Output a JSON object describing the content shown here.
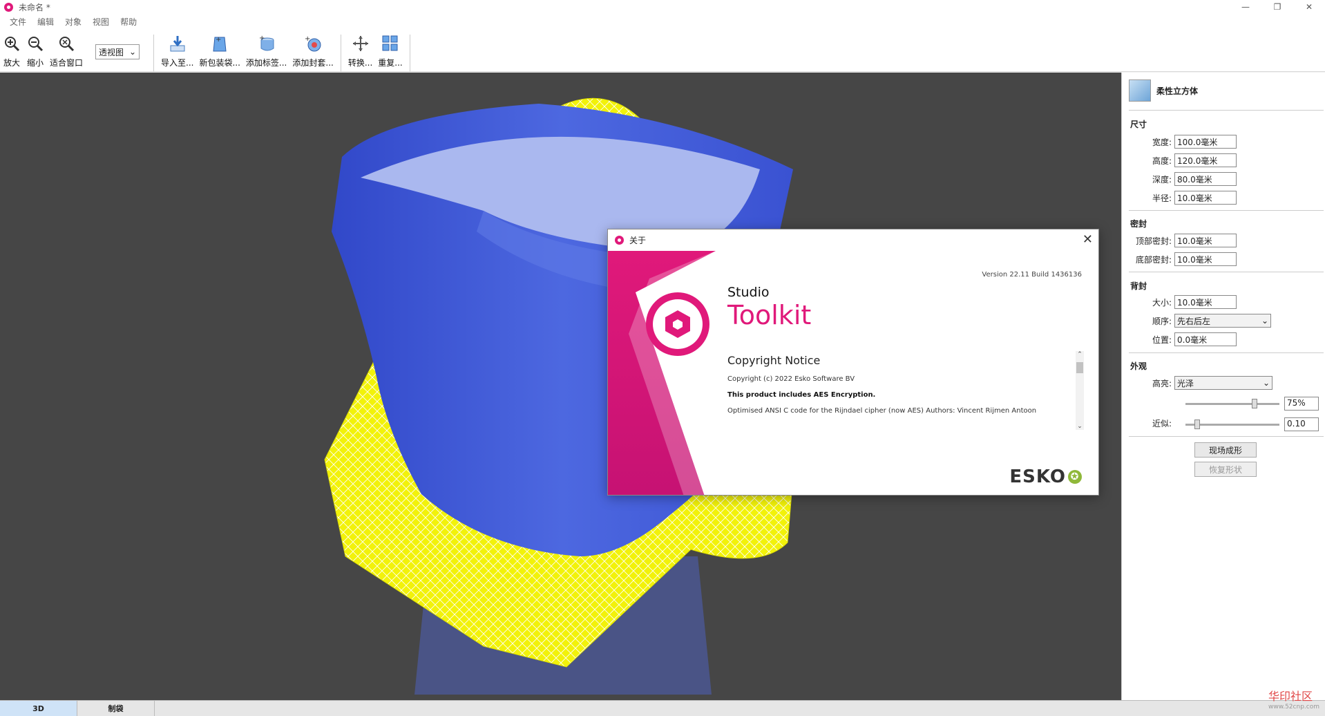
{
  "window": {
    "title": "未命名 *",
    "min": "—",
    "max": "❐",
    "close": "✕"
  },
  "menu": [
    "文件",
    "编辑",
    "对象",
    "视图",
    "帮助"
  ],
  "toolbar": {
    "zoom_in": "放大",
    "zoom_out": "缩小",
    "fit_window": "适合窗口",
    "view_mode": "透视图",
    "import_to": "导入至...",
    "new_bag": "新包装袋...",
    "add_label": "添加标签...",
    "add_seal": "添加封套...",
    "transform": "转换...",
    "repeat": "重复..."
  },
  "panel": {
    "object_name": "柔性立方体",
    "size": {
      "title": "尺寸",
      "width_label": "宽度:",
      "width": "100.0毫米",
      "height_label": "高度:",
      "height": "120.0毫米",
      "depth_label": "深度:",
      "depth": "80.0毫米",
      "radius_label": "半径:",
      "radius": "10.0毫米"
    },
    "seal": {
      "title": "密封",
      "top_label": "顶部密封:",
      "top": "10.0毫米",
      "bottom_label": "底部密封:",
      "bottom": "10.0毫米"
    },
    "back_seal": {
      "title": "背封",
      "size_label": "大小:",
      "size": "10.0毫米",
      "order_label": "顺序:",
      "order": "先右后左",
      "position_label": "位置:",
      "position": "0.0毫米"
    },
    "appearance": {
      "title": "外观",
      "highlight_label": "高亮:",
      "highlight": "光泽",
      "highlight_value": "75%",
      "highlight_level": 0.75,
      "approx_label": "近似:",
      "approx_value": "0.10",
      "approx_level": 0.1
    },
    "form_button": "现场成形",
    "restore_button": "恢复形状"
  },
  "tabs": [
    "3D",
    "制袋"
  ],
  "watermark": {
    "title": "华印社区",
    "url": "www.52cnp.com"
  },
  "dialog": {
    "title": "关于",
    "close": "✕",
    "version": "Version 22.11 Build 1436136",
    "product_line1": "Studio",
    "product_line2": "Toolkit",
    "copyright_heading": "Copyright Notice",
    "copyright_line": "Copyright (c) 2022 Esko Software BV",
    "aes_line": "This product includes AES Encryption.",
    "optimised_line": "Optimised ANSI C code for the Rijndael cipher (now AES) Authors: Vincent Rijmen Antoon",
    "brand": "ESKO",
    "scroll_up": "⌃",
    "scroll_down": "⌄"
  },
  "colors": {
    "brand_pink": "#e0197a",
    "viewport_bg": "#464646",
    "bag_blue": "#3b55d8",
    "mesh_yellow": "#f2f20a",
    "esko_green": "#8fb839"
  }
}
